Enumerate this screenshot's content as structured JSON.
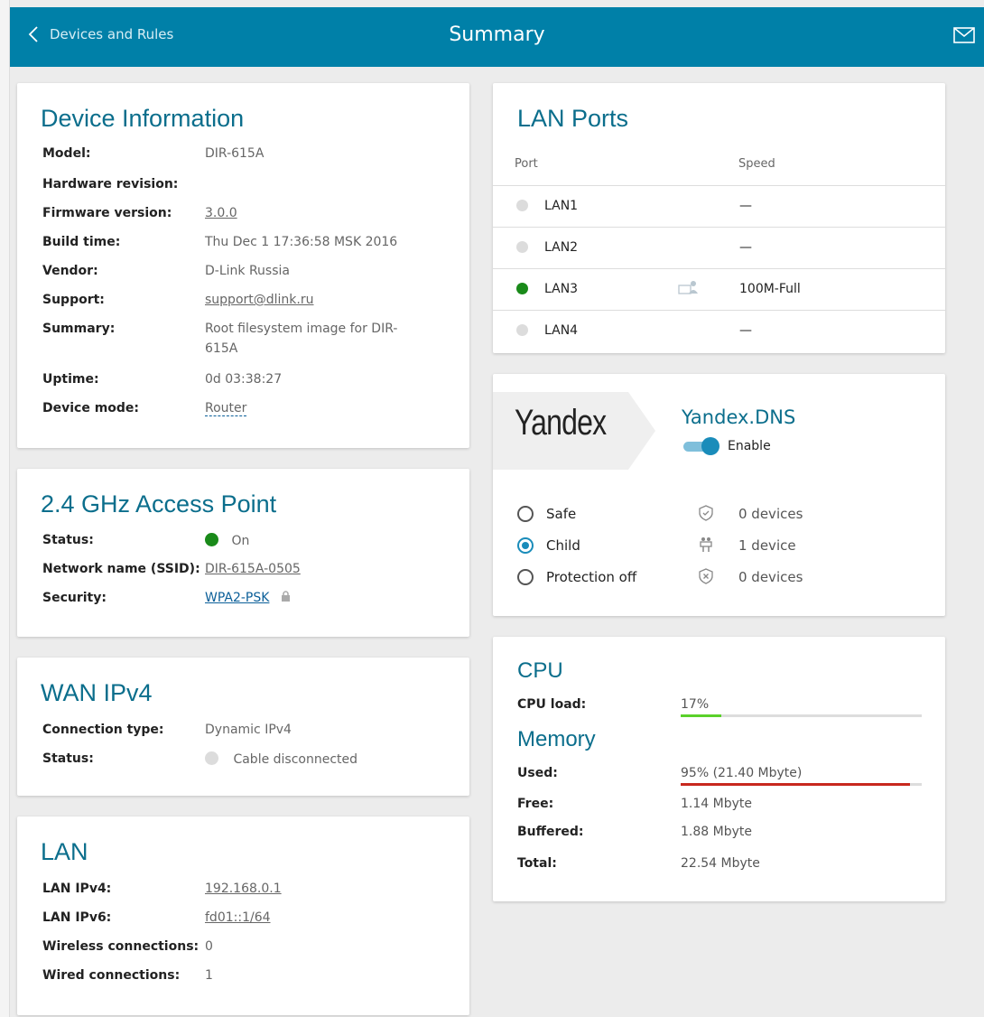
{
  "header": {
    "back_label": "Devices and Rules",
    "title": "Summary"
  },
  "device_info": {
    "title": "Device Information",
    "rows": [
      {
        "label": "Model:",
        "value": "DIR-615A"
      },
      {
        "label": "Hardware revision:",
        "value": ""
      },
      {
        "label": "Firmware version:",
        "value": "3.0.0"
      },
      {
        "label": "Build time:",
        "value": "Thu Dec 1 17:36:58 MSK 2016"
      },
      {
        "label": "Vendor:",
        "value": "D-Link Russia"
      },
      {
        "label": "Support:",
        "value": "support@dlink.ru"
      },
      {
        "label": "Summary:",
        "value_line1": "Root filesystem image for DIR-",
        "value_line2": "615A"
      },
      {
        "label": "Uptime:",
        "value": "0d 03:38:27"
      },
      {
        "label": "Device mode:",
        "value": "Router"
      }
    ]
  },
  "access_point": {
    "title": "2.4 GHz Access Point",
    "status_label": "Status:",
    "status_value": "On",
    "ssid_label": "Network name (SSID):",
    "ssid_value": "DIR-615A-0505",
    "security_label": "Security:",
    "security_value": "WPA2-PSK"
  },
  "wan": {
    "title": "WAN IPv4",
    "conn_type_label": "Connection type:",
    "conn_type_value": "Dynamic IPv4",
    "status_label": "Status:",
    "status_value": "Cable disconnected"
  },
  "lan": {
    "title": "LAN",
    "ipv4_label": "LAN IPv4:",
    "ipv4_value": "192.168.0.1",
    "ipv6_label": "LAN IPv6:",
    "ipv6_value": "fd01::1/64",
    "wireless_label": "Wireless connections:",
    "wireless_value": "0",
    "wired_label": "Wired connections:",
    "wired_value": "1"
  },
  "lan_ports": {
    "title": "LAN Ports",
    "col_port": "Port",
    "col_speed": "Speed",
    "ports": [
      {
        "name": "LAN1",
        "speed": "—",
        "active": false
      },
      {
        "name": "LAN2",
        "speed": "—",
        "active": false
      },
      {
        "name": "LAN3",
        "speed": "100M-Full",
        "active": true
      },
      {
        "name": "LAN4",
        "speed": "—",
        "active": false
      }
    ]
  },
  "yandex": {
    "logo_text": "Yandex",
    "title": "Yandex.DNS",
    "enable_label": "Enable",
    "enabled": true,
    "modes": [
      {
        "label": "Safe",
        "count": "0 devices",
        "selected": false,
        "icon": "shield-check-icon"
      },
      {
        "label": "Child",
        "count": "1 device",
        "selected": true,
        "icon": "child-icon"
      },
      {
        "label": "Protection off",
        "count": "0 devices",
        "selected": false,
        "icon": "shield-x-icon"
      }
    ]
  },
  "cpu": {
    "title": "CPU",
    "load_label": "CPU load:",
    "load_value": "17%",
    "load_fraction": 0.17,
    "load_color": "#5ad12a"
  },
  "memory": {
    "title": "Memory",
    "used_label": "Used:",
    "used_value": "95% (21.40 Mbyte)",
    "used_fraction": 0.95,
    "used_color": "#c8281e",
    "free_label": "Free:",
    "free_value": "1.14 Mbyte",
    "buffered_label": "Buffered:",
    "buffered_value": "1.88 Mbyte",
    "total_label": "Total:",
    "total_value": "22.54 Mbyte"
  },
  "colors": {
    "header_bg": "#0080a8",
    "title_color": "#0b6e8c",
    "link_color": "#0b5f99",
    "accent": "#1a8cba"
  }
}
